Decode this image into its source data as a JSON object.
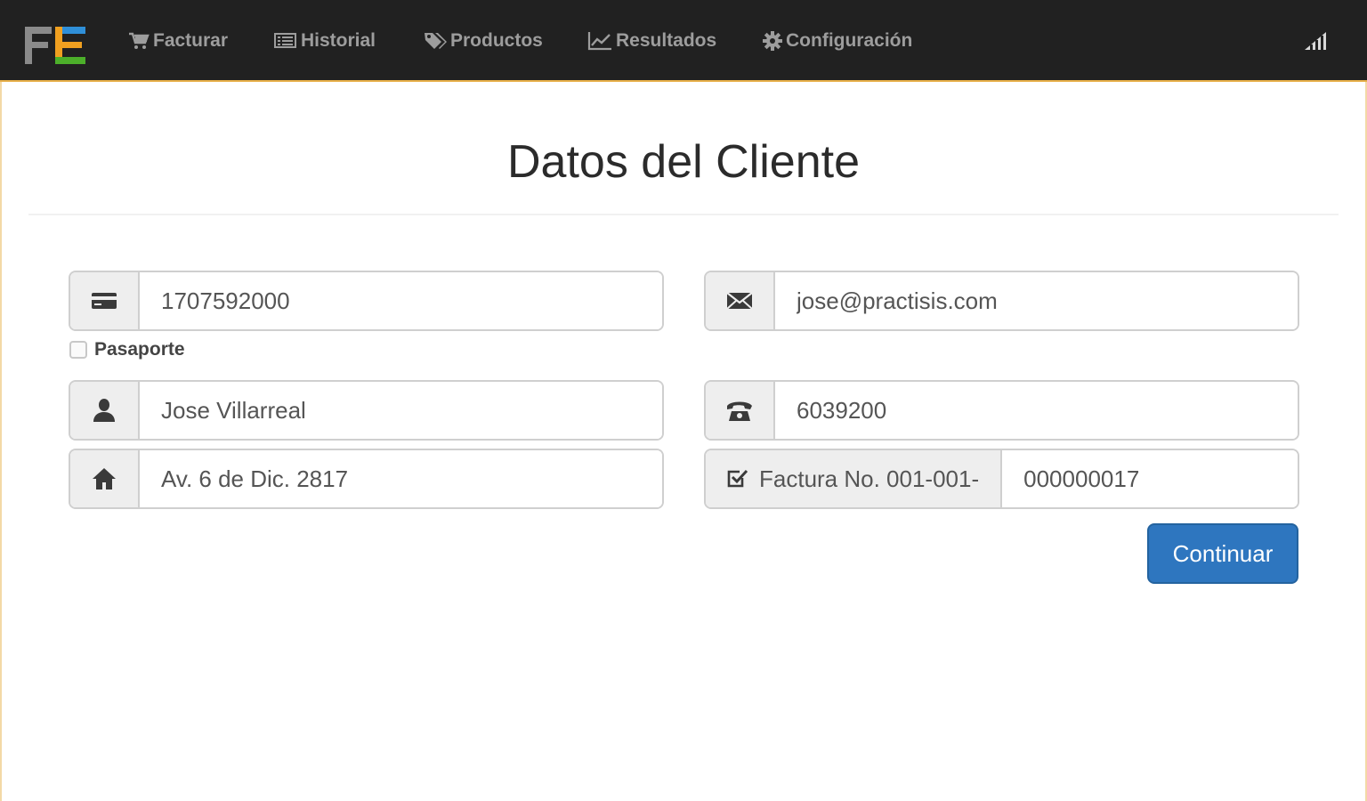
{
  "nav": {
    "logo_text": "FE",
    "items": [
      {
        "label": "Facturar",
        "icon": "shopping-cart-icon"
      },
      {
        "label": "Historial",
        "icon": "list-icon"
      },
      {
        "label": "Productos",
        "icon": "tags-icon"
      },
      {
        "label": "Resultados",
        "icon": "line-chart-icon"
      },
      {
        "label": "Configuración",
        "icon": "gear-icon"
      }
    ],
    "right_icon": "signal-icon"
  },
  "page": {
    "title": "Datos del Cliente"
  },
  "form": {
    "id_value": "1707592000",
    "passport_label": "Pasaporte",
    "name_value": "Jose Villarreal",
    "address_value": "Av. 6 de Dic. 2817",
    "email_value": "jose@practisis.com",
    "phone_value": "6039200",
    "invoice_prefix": "Factura No. 001-001-",
    "invoice_value": "000000017",
    "continue_label": "Continuar"
  },
  "colors": {
    "navbar_bg": "#212121",
    "accent_border": "#e8b04a",
    "primary_button": "#2e76bf",
    "logo_blue": "#2f8fd8",
    "logo_orange": "#f0a020",
    "logo_green": "#4caf2a"
  }
}
